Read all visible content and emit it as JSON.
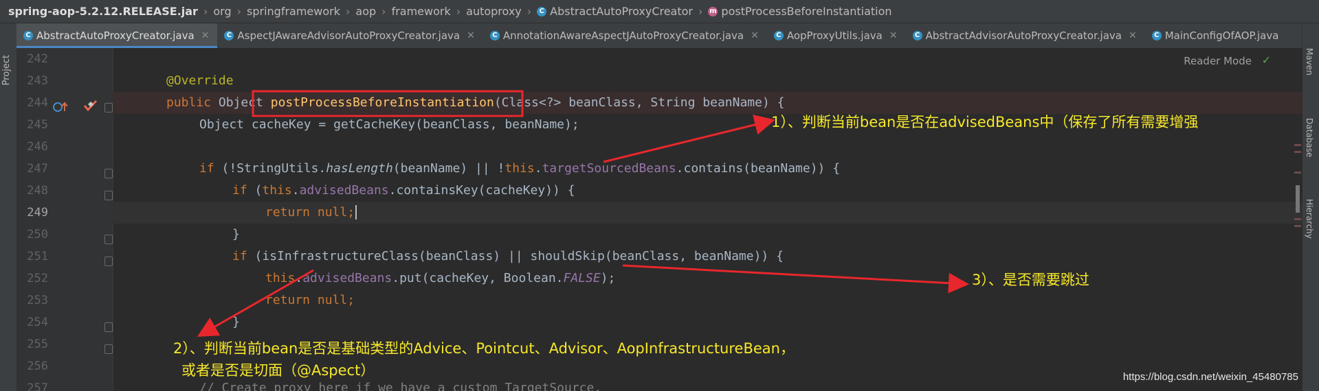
{
  "breadcrumb": {
    "items": [
      "spring-aop-5.2.12.RELEASE.jar",
      "org",
      "springframework",
      "aop",
      "framework",
      "autoproxy",
      "AbstractAutoProxyCreator",
      "postProcessBeforeInstantiation"
    ]
  },
  "side_panels": {
    "left": "Project",
    "right": [
      "Maven",
      "Database",
      "Hierarchy"
    ]
  },
  "tabs": [
    {
      "label": "AbstractAutoProxyCreator.java",
      "active": true
    },
    {
      "label": "AspectJAwareAdvisorAutoProxyCreator.java",
      "active": false
    },
    {
      "label": "AnnotationAwareAspectJAutoProxyCreator.java",
      "active": false
    },
    {
      "label": "AopProxyUtils.java",
      "active": false
    },
    {
      "label": "AbstractAdvisorAutoProxyCreator.java",
      "active": false
    },
    {
      "label": "MainConfigOfAOP.java",
      "active": false
    }
  ],
  "editor": {
    "reader_mode": "Reader Mode",
    "current_line": "249",
    "line_numbers": [
      "242",
      "243",
      "244",
      "245",
      "246",
      "247",
      "248",
      "249",
      "250",
      "251",
      "252",
      "253",
      "254",
      "255",
      "256",
      "257"
    ]
  },
  "code": {
    "l243": {
      "ann": "@Override"
    },
    "l244": {
      "kw1": "public",
      "t1": " Object ",
      "fn": "postProcessBeforeInstantiation",
      "t2": "(Class<?> beanClass, ",
      "t3": "String beanName) {"
    },
    "l245": {
      "t1": "Object cacheKey = getCacheKey(beanClass, beanName);"
    },
    "l247": {
      "kw1": "if",
      "t1": " (!StringUtils.",
      "it": "hasLength",
      "t2": "(beanName) || !",
      "kw2": "this",
      "t3": ".",
      "fld": "targetSourcedBeans",
      "t4": ".contains(beanName)) {"
    },
    "l248": {
      "kw1": "if",
      "t1": " (",
      "kw2": "this",
      "t2": ".",
      "fld": "advisedBeans",
      "t3": ".containsKey(cacheKey)) {"
    },
    "l249": {
      "kw1": "return",
      "kw2": " null",
      "t1": ";"
    },
    "l250": {
      "t1": "}"
    },
    "l251": {
      "kw1": "if",
      "t1": " (isInfrastructureClass(beanClass) || shouldSkip(beanClass, beanName)) {"
    },
    "l252": {
      "kw1": "this",
      "t1": ".",
      "fld": "advisedBeans",
      "t2": ".put(cacheKey, Boolean.",
      "fldit": "FALSE",
      "t3": ");"
    },
    "l253": {
      "kw1": "return",
      "kw2": " null",
      "t1": ";"
    },
    "l254": {
      "t1": "}"
    },
    "l257": {
      "cmt": "// Create proxy here if we have a custom TargetSource."
    }
  },
  "annotations": {
    "note1": "1）、判断当前bean是否在advisedBeans中（保存了所有需要增强",
    "note2_line1": "2）、判断当前bean是否是基础类型的Advice、Pointcut、Advisor、AopInfrastructureBean，",
    "note2_line2": "或者是否是切面（@Aspect）",
    "note3": "3）、是否需要跳过",
    "color": "#f7e82a",
    "arrow_color": "#e8272d"
  },
  "watermark": "https://blog.csdn.net/weixin_45480785"
}
